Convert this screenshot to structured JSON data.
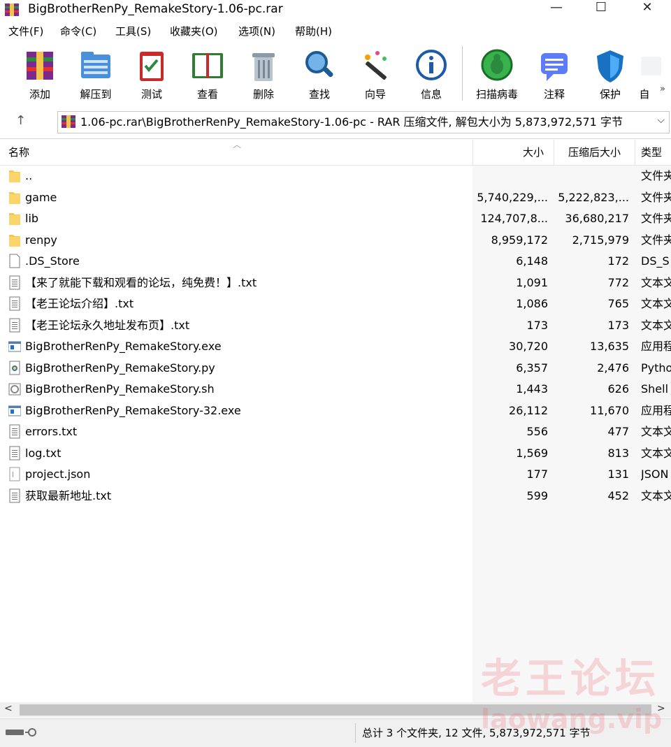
{
  "window": {
    "title": "BigBrotherRenPy_RemakeStory-1.06-pc.rar",
    "minimize": "—",
    "maximize": "☐",
    "close": "✕"
  },
  "menu": [
    "文件(F)",
    "命令(C)",
    "工具(S)",
    "收藏夹(O)",
    "选项(N)",
    "帮助(H)"
  ],
  "toolbar": {
    "tools": [
      {
        "label": "添加",
        "icon": "add-archive-icon"
      },
      {
        "label": "解压到",
        "icon": "extract-folder-icon"
      },
      {
        "label": "测试",
        "icon": "test-clipboard-icon"
      },
      {
        "label": "查看",
        "icon": "view-book-icon"
      },
      {
        "label": "删除",
        "icon": "trash-icon"
      },
      {
        "label": "查找",
        "icon": "magnifier-icon"
      },
      {
        "label": "向导",
        "icon": "wizard-wand-icon"
      },
      {
        "label": "信息",
        "icon": "info-icon"
      },
      {
        "label": "扫描病毒",
        "icon": "virus-scan-icon"
      },
      {
        "label": "注释",
        "icon": "comment-icon"
      },
      {
        "label": "保护",
        "icon": "shield-icon"
      },
      {
        "label": "自",
        "icon": "more-icon"
      }
    ],
    "overflow": "»"
  },
  "address": {
    "up": "↑",
    "path": "1.06-pc.rar\\BigBrotherRenPy_RemakeStory-1.06-pc - RAR 压缩文件, 解包大小为 5,873,972,571 字节",
    "dropdown": "⌵"
  },
  "columns": {
    "name": "名称",
    "size": "大小",
    "packed": "压缩后大小",
    "type": "类型",
    "sort_indicator": "︿"
  },
  "files": [
    {
      "name": "..",
      "size": "",
      "packed": "",
      "type": "文件夹",
      "kind": "folder"
    },
    {
      "name": "game",
      "size": "5,740,229,...",
      "packed": "5,222,823,...",
      "type": "文件夹",
      "kind": "folder"
    },
    {
      "name": "lib",
      "size": "124,707,8...",
      "packed": "36,680,217",
      "type": "文件夹",
      "kind": "folder"
    },
    {
      "name": "renpy",
      "size": "8,959,172",
      "packed": "2,715,979",
      "type": "文件夹",
      "kind": "folder"
    },
    {
      "name": ".DS_Store",
      "size": "6,148",
      "packed": "172",
      "type": "DS_S",
      "kind": "blank"
    },
    {
      "name": "【来了就能下载和观看的论坛，纯免费！】.txt",
      "size": "1,091",
      "packed": "772",
      "type": "文本文",
      "kind": "text"
    },
    {
      "name": "【老王论坛介绍】.txt",
      "size": "1,086",
      "packed": "765",
      "type": "文本文",
      "kind": "text"
    },
    {
      "name": "【老王论坛永久地址发布页】.txt",
      "size": "173",
      "packed": "173",
      "type": "文本文",
      "kind": "text"
    },
    {
      "name": "BigBrotherRenPy_RemakeStory.exe",
      "size": "30,720",
      "packed": "13,635",
      "type": "应用程",
      "kind": "exe"
    },
    {
      "name": "BigBrotherRenPy_RemakeStory.py",
      "size": "6,357",
      "packed": "2,476",
      "type": "Pytho",
      "kind": "py"
    },
    {
      "name": "BigBrotherRenPy_RemakeStory.sh",
      "size": "1,443",
      "packed": "626",
      "type": "Shell",
      "kind": "sh"
    },
    {
      "name": "BigBrotherRenPy_RemakeStory-32.exe",
      "size": "26,112",
      "packed": "11,670",
      "type": "应用程",
      "kind": "exe"
    },
    {
      "name": "errors.txt",
      "size": "556",
      "packed": "477",
      "type": "文本文",
      "kind": "text"
    },
    {
      "name": "log.txt",
      "size": "1,569",
      "packed": "813",
      "type": "文本文",
      "kind": "text"
    },
    {
      "name": "project.json",
      "size": "177",
      "packed": "131",
      "type": "JSON",
      "kind": "json"
    },
    {
      "name": "获取最新地址.txt",
      "size": "599",
      "packed": "452",
      "type": "文本文",
      "kind": "text"
    }
  ],
  "scrollbar": {
    "left": "<",
    "right": ">"
  },
  "status": {
    "summary": "总计 3 个文件夹, 12 文件, 5,873,972,571 字节"
  },
  "watermark": {
    "line1": "老王论坛",
    "line2": "laowang.vip"
  },
  "colors": {
    "folder": "#f8c64f",
    "accent": "#1e73c8",
    "watermark": "#f05a6e"
  }
}
